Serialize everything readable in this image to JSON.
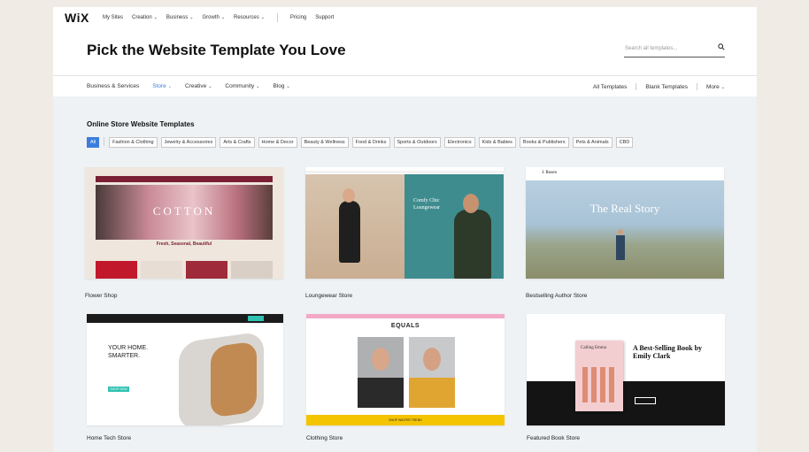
{
  "nav": {
    "logo": "WiX",
    "links": [
      "My Sites",
      "Creation",
      "Business",
      "Growth",
      "Resources"
    ],
    "extra": [
      "Pricing",
      "Support"
    ]
  },
  "heading": "Pick the Website Template You Love",
  "search": {
    "placeholder": "Search all templates..."
  },
  "categories": {
    "left": [
      "Business & Services",
      "Store",
      "Creative",
      "Community",
      "Blog"
    ],
    "right": [
      "All Templates",
      "Blank Templates",
      "More"
    ]
  },
  "section_title": "Online Store Website Templates",
  "chips": [
    "All",
    "Fashion & Clothing",
    "Jewelry & Accessories",
    "Arts & Crafts",
    "Home & Decor",
    "Beauty & Wellness",
    "Food & Drinks",
    "Sports & Outdoors",
    "Electronics",
    "Kids & Babies",
    "Books & Publishers",
    "Pets & Animals",
    "CBD"
  ],
  "templates": [
    {
      "name": "Flower Shop",
      "hero": "COTTON",
      "tagline": "Fresh, Seasonal, Beautiful"
    },
    {
      "name": "Loungewear Store",
      "hero": "Comfy Chic Loungewear"
    },
    {
      "name": "Bestselling Author Store",
      "hero": "The Real Story",
      "brand": "J. Rosen"
    },
    {
      "name": "Home Tech Store",
      "hero": "YOUR HOME. SMARTER.",
      "cta": "SHOP NOW"
    },
    {
      "name": "Clothing Store",
      "hero": "EQUALS",
      "cta": "SHOP WINTER TREND"
    },
    {
      "name": "Featured Book Store",
      "hero": "A Best-Selling Book by Emily Clark",
      "cover": "Calling Emma"
    }
  ],
  "colors": {
    "accent": "#3b7ddd",
    "content_bg": "#eef2f4",
    "outer_bg": "#f0ebe4"
  }
}
